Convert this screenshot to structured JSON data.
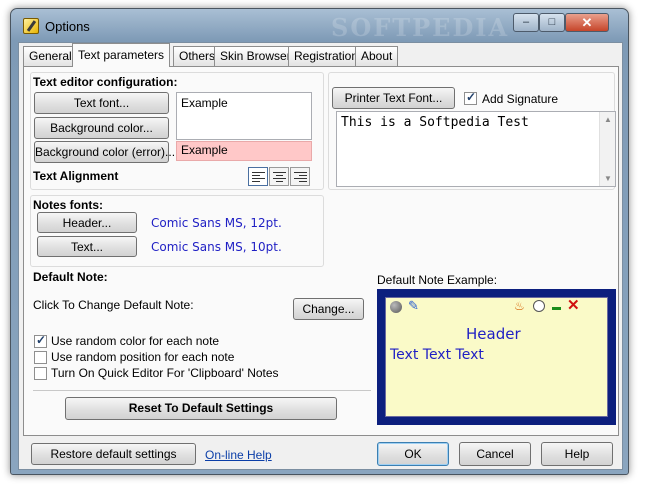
{
  "window": {
    "title": "Options",
    "watermark": "SOFTPEDIA"
  },
  "tabs": [
    {
      "label": "General"
    },
    {
      "label": "Text parameters"
    },
    {
      "label": "Others"
    },
    {
      "label": "Skin Browser"
    },
    {
      "label": "Registration"
    },
    {
      "label": "About"
    }
  ],
  "text_editor": {
    "title": "Text editor configuration:",
    "text_font_button": "Text font...",
    "background_color_button": "Background color...",
    "background_color_error_button": "Background color (error)...",
    "example_label": "Example",
    "example_error_label": "Example",
    "alignment_label": "Text Alignment"
  },
  "printer": {
    "printer_font_button": "Printer Text Font...",
    "add_signature_label": "Add Signature",
    "add_signature_checked": true,
    "signature_text": "This is a Softpedia Test"
  },
  "notes_fonts": {
    "title": "Notes fonts:",
    "header_button": "Header...",
    "header_font": "Comic Sans MS, 12pt.",
    "text_button": "Text...",
    "text_font": "Comic Sans MS, 10pt."
  },
  "default_note": {
    "title": "Default Note:",
    "click_label": "Click To Change Default Note:",
    "change_button": "Change...",
    "options": [
      {
        "label": "Use random color for each note",
        "checked": true
      },
      {
        "label": "Use random position for each note",
        "checked": false
      },
      {
        "label": "Turn On Quick Editor For 'Clipboard' Notes",
        "checked": false
      }
    ],
    "reset_button": "Reset To Default Settings",
    "example_label": "Default Note Example:",
    "example_header": "Header",
    "example_text": "Text Text Text"
  },
  "footer": {
    "restore_button": "Restore default settings",
    "online_help": "On-line Help",
    "ok_button": "OK",
    "cancel_button": "Cancel",
    "help_button": "Help"
  },
  "colors": {
    "error_background": "#ffc8c8",
    "note_background": "#fafac8",
    "note_border": "#0c1f7e",
    "font_text": "#1f1fc4"
  }
}
